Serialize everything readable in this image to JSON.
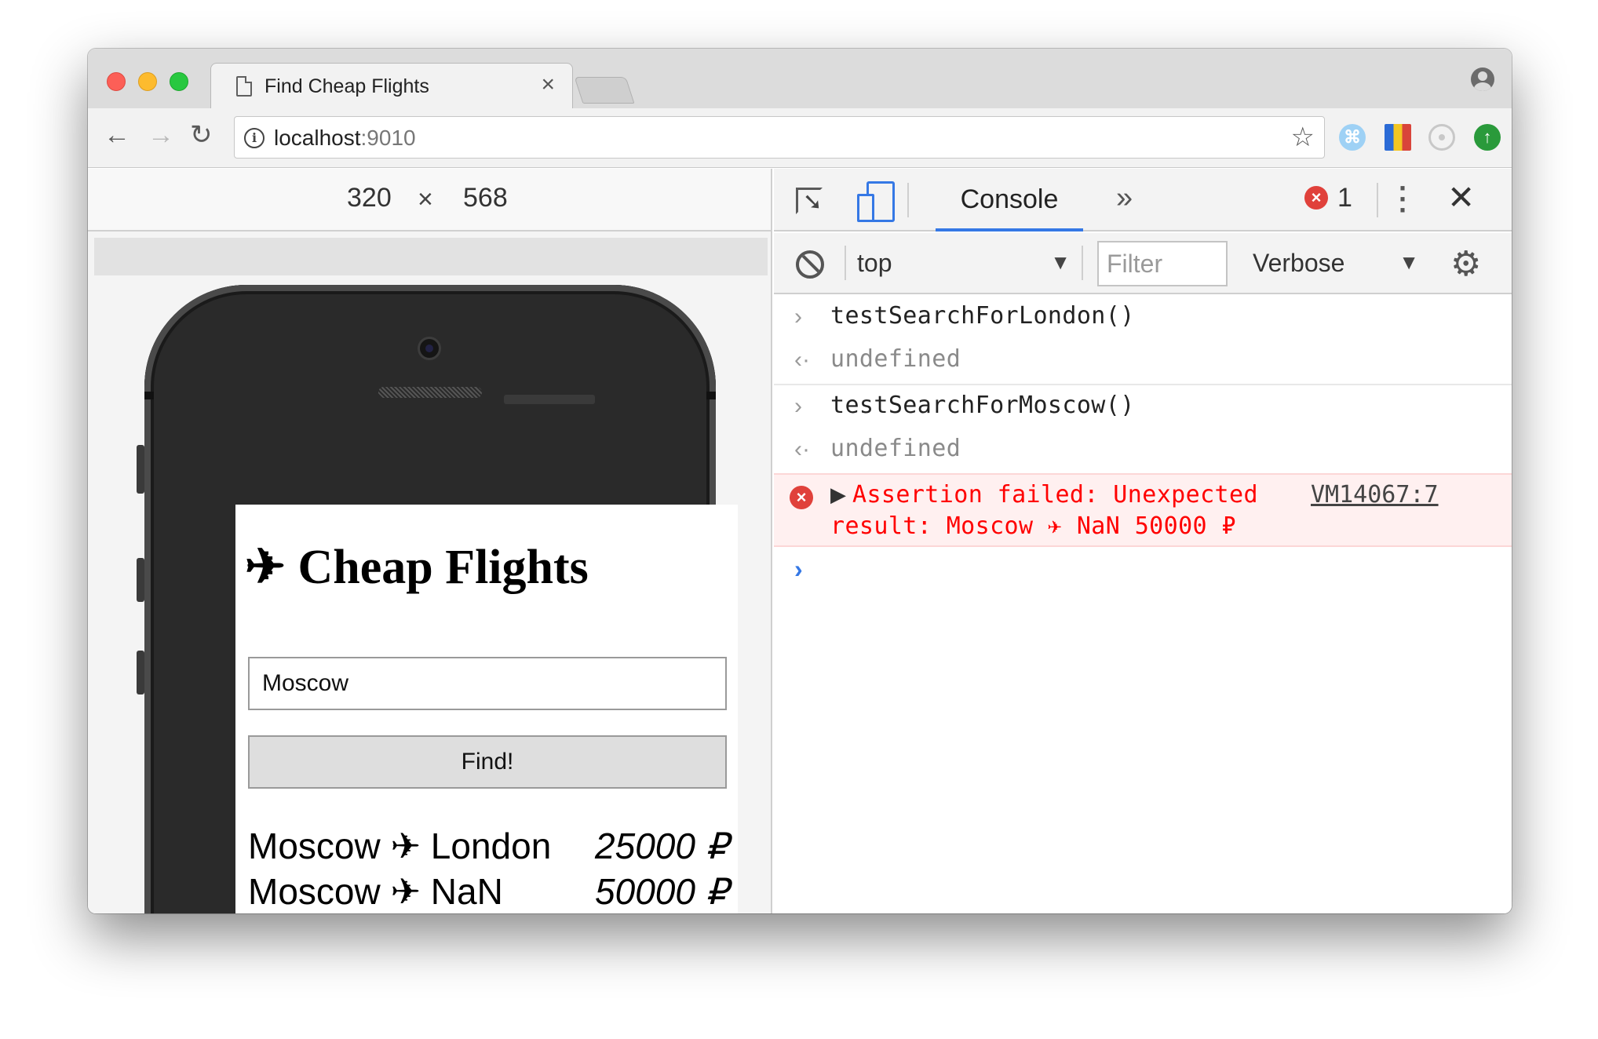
{
  "window": {
    "tab_title": "Find Cheap Flights",
    "tab_close": "×",
    "address": {
      "host": "localhost",
      "port": ":9010"
    }
  },
  "device": {
    "width": "320",
    "times": "×",
    "height": "568"
  },
  "app": {
    "title": "✈ Cheap Flights",
    "input_value": "Moscow",
    "button_label": "Find!",
    "results": [
      {
        "route": "Moscow ✈ London",
        "price": "25000 ₽"
      },
      {
        "route": "Moscow ✈ NaN",
        "price": "50000 ₽"
      }
    ]
  },
  "devtools": {
    "active_tab": "Console",
    "more_tabs": "»",
    "error_count": "1",
    "context": "top",
    "filter_placeholder": "Filter",
    "level": "Verbose",
    "entries": [
      {
        "command": "testSearchForLondon()",
        "result": "undefined"
      },
      {
        "command": "testSearchForMoscow()",
        "result": "undefined"
      }
    ],
    "error": {
      "line1": "Assertion failed: Unexpected",
      "line2": "result: Moscow ✈ NaN 50000 ₽",
      "source": "VM14067:7"
    }
  },
  "colors": {
    "accent": "#3578e5",
    "error_red": "#ff0000",
    "error_bg": "#fff0f0"
  },
  "icons": [
    "info-icon",
    "star-icon",
    "profile-icon",
    "file-icon",
    "inspect-icon",
    "device-toolbar-icon",
    "clear-console-icon",
    "gear-icon",
    "error-icon"
  ]
}
